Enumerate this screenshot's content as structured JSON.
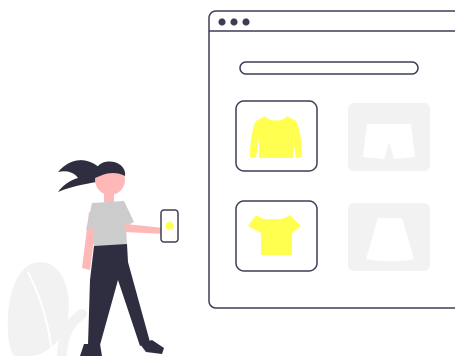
{
  "colors": {
    "accent": "#FFFF4F",
    "outline": "#3F3D56",
    "tile_inactive": "#F2F2F2",
    "skin": "#FFB8B8",
    "hair": "#2F2E41",
    "shirt": "#CCCCCC",
    "decor": "#F2F2F2"
  },
  "browser": {
    "window_controls": [
      "dot-icon",
      "dot-icon",
      "dot-icon"
    ],
    "search_bar": {
      "value": "",
      "placeholder": ""
    }
  },
  "product_grid": [
    {
      "icon": "long-sleeve-top-icon",
      "state": "selected"
    },
    {
      "icon": "shorts-icon",
      "state": "inactive"
    },
    {
      "icon": "crop-top-icon",
      "state": "selected"
    },
    {
      "icon": "skirt-icon",
      "state": "inactive"
    }
  ],
  "illustration": {
    "figure": "woman-holding-phone",
    "phone_icon": "phone-icon",
    "decor_icon": "leaf-icon"
  }
}
